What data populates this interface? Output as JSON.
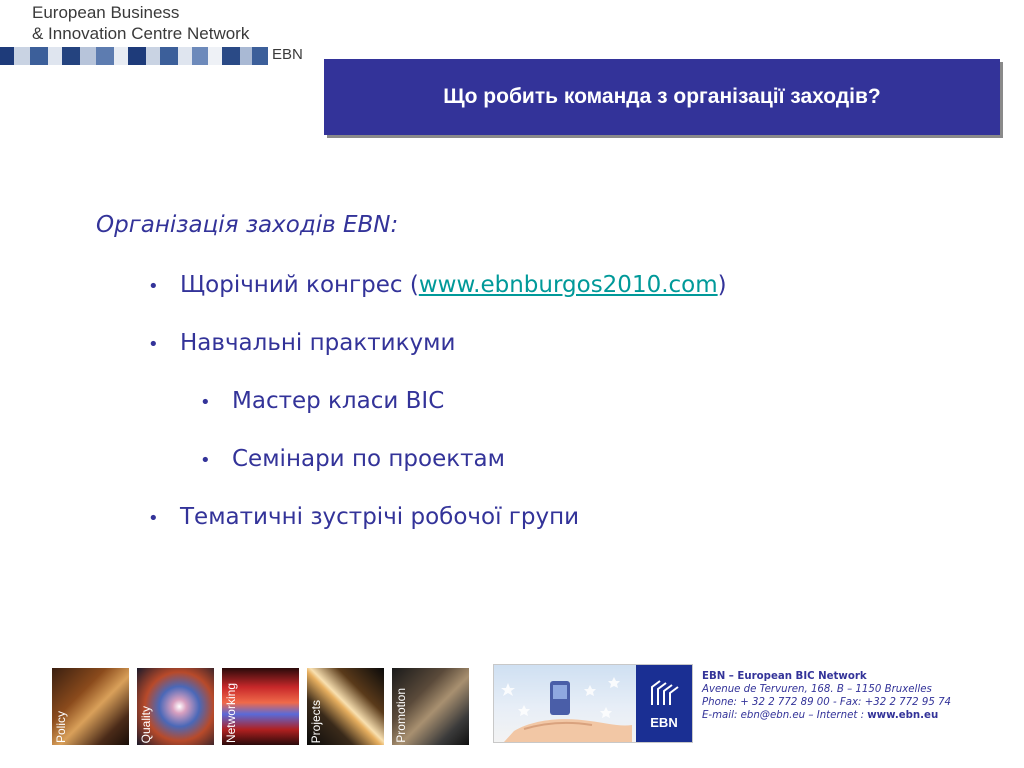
{
  "header": {
    "logo_line1": "European Business",
    "logo_line2": "& Innovation Centre Network",
    "logo_abbr": "EBN",
    "title": "Що робить команда з організації заходів?"
  },
  "content": {
    "heading": "Організація заходів EBN:",
    "bullet_glyph": "•",
    "items": [
      {
        "prefix": "Щорічний конгрес (",
        "link": "www.ebnburgos2010.com",
        "suffix": ")"
      },
      {
        "text": "Навчальні практикуми"
      },
      {
        "text": "Мастер класи BIC"
      },
      {
        "text": "Семінари по проектам"
      },
      {
        "text": "Тематичні зустрічі робочої групи"
      }
    ]
  },
  "footer": {
    "photos": [
      "Policy",
      "Quality",
      "Networking",
      "Projects",
      "Promotion"
    ],
    "image_logo_text": "EBN",
    "contact": {
      "org": "EBN – European BIC Network",
      "address": "Avenue de Tervuren, 168.  B – 1150 Bruxelles",
      "phone": "Phone: + 32 2 772 89 00 - Fax: +32 2 772 95 74",
      "email_prefix": "E-mail: ebn@ebn.eu – Internet : ",
      "website": "www.ebn.eu"
    }
  },
  "colors": {
    "accent": "#333399",
    "link": "#009999",
    "title_bg": "#333399"
  }
}
